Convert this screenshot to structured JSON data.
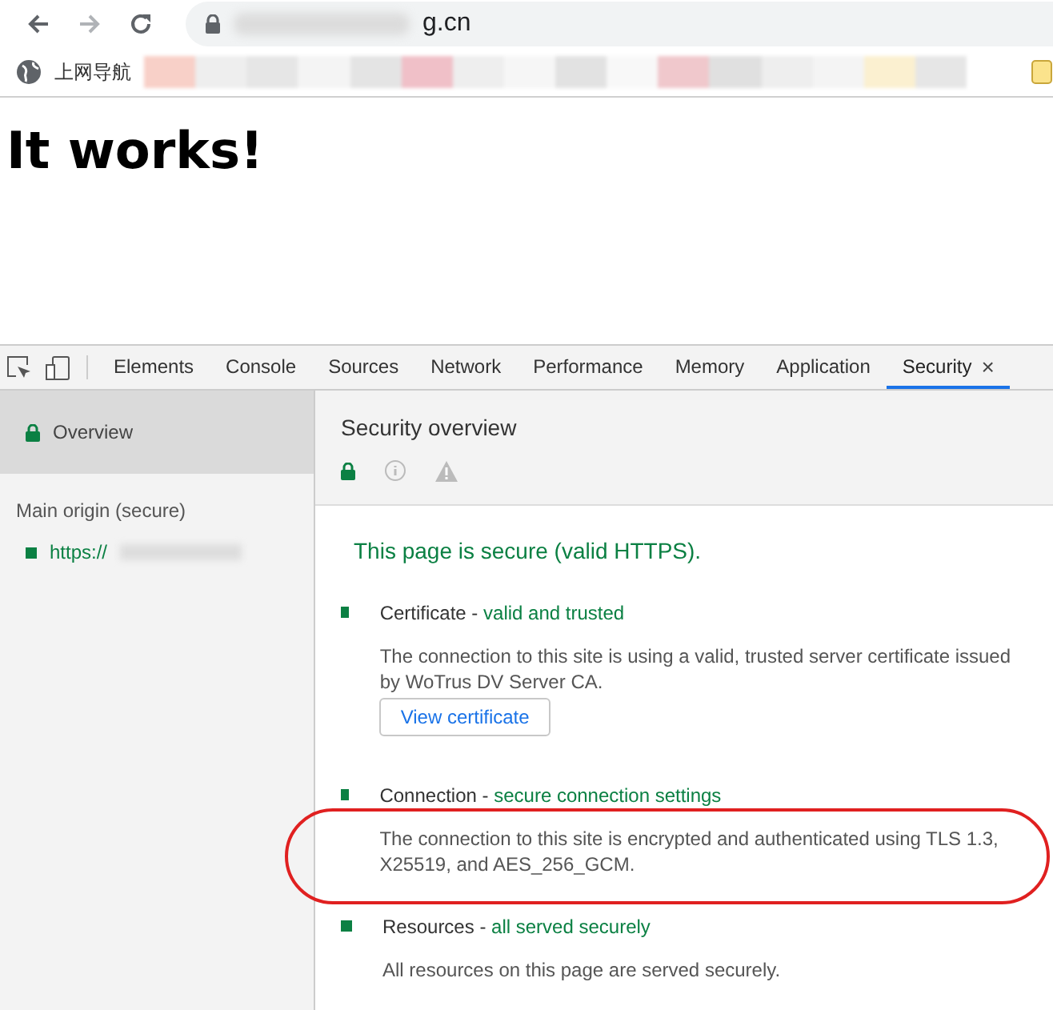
{
  "browser": {
    "url": "g.cn",
    "bookmarks": [
      {
        "label": "上网导航"
      }
    ]
  },
  "page": {
    "heading": "It works!"
  },
  "devtools": {
    "tabs": [
      {
        "label": "Elements",
        "selected": false
      },
      {
        "label": "Console",
        "selected": false
      },
      {
        "label": "Sources",
        "selected": false
      },
      {
        "label": "Network",
        "selected": false
      },
      {
        "label": "Performance",
        "selected": false
      },
      {
        "label": "Memory",
        "selected": false
      },
      {
        "label": "Application",
        "selected": false
      },
      {
        "label": "Security",
        "selected": true
      }
    ],
    "close": "×",
    "sidebar": {
      "items": [
        {
          "label": "Overview",
          "selected": true
        }
      ],
      "section_title": "Main origin (secure)",
      "origins": [
        {
          "label": "https://",
          "color": "#0b8043"
        }
      ]
    },
    "overview": {
      "title": "Security overview",
      "summary": "This page is secure (valid HTTPS).",
      "sections": [
        {
          "title": "Certificate -",
          "status": "valid and trusted",
          "description": "The connection to this site is using a valid, trusted server certificate issued by WoTrus DV Server CA.",
          "button": "View certificate",
          "color": "#0b8043"
        },
        {
          "title": "Connection -",
          "status": "secure connection settings",
          "description": "The connection to this site is encrypted and authenticated using TLS 1.3, X25519, and AES_256_GCM.",
          "color": "#0b8043"
        },
        {
          "title": "Resources -",
          "status": "all served securely",
          "description": "All resources on this page are served securely.",
          "color": "#0b8043"
        }
      ]
    }
  }
}
